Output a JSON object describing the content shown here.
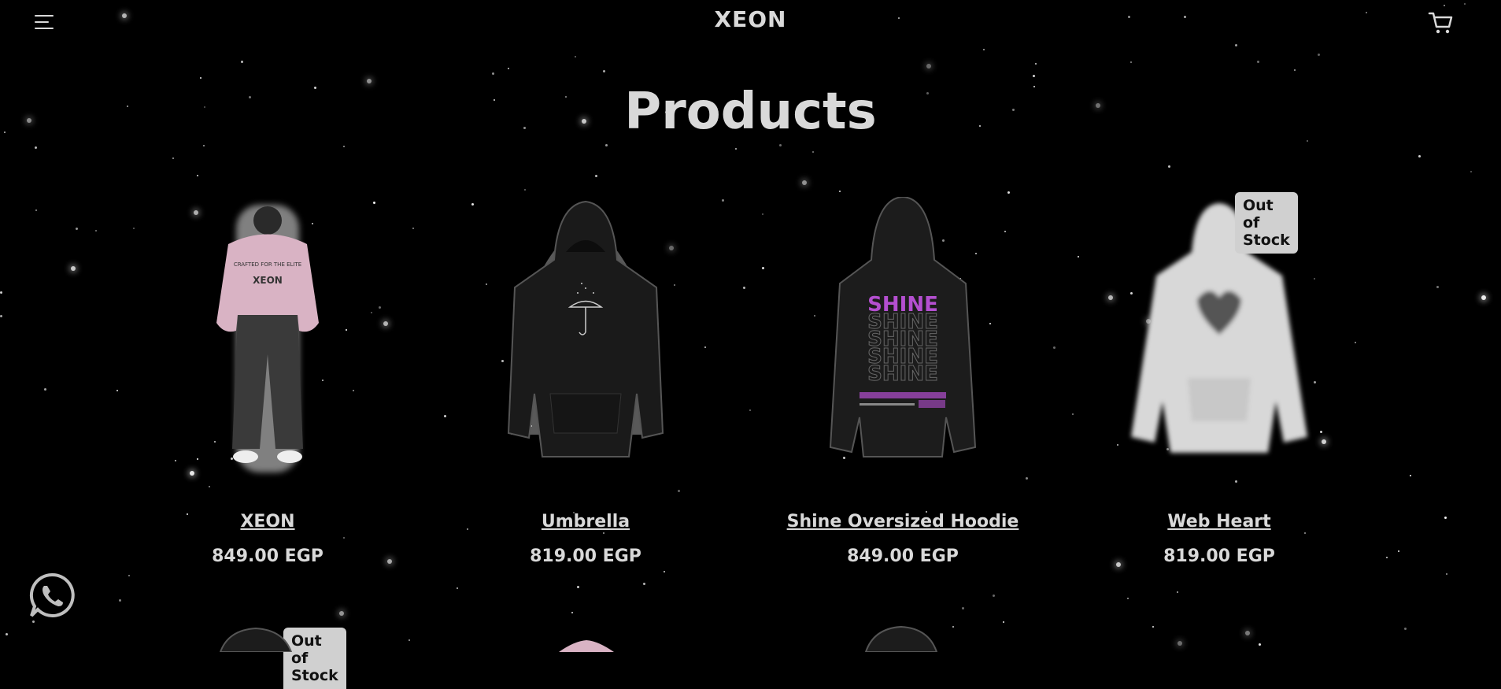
{
  "header": {
    "logo": "XEON",
    "menu_icon": "hamburger-menu-icon",
    "cart_icon": "cart-icon"
  },
  "page": {
    "title": "Products"
  },
  "products": [
    {
      "name": "XEON",
      "price": "849.00 EGP",
      "badge": "",
      "image": "pink-hoodie-model-photo",
      "color": "#d9b3c4"
    },
    {
      "name": "Umbrella",
      "price": "819.00 EGP",
      "badge": "",
      "image": "black-hoodie-umbrella-photo",
      "color": "#1a1a1a"
    },
    {
      "name": "Shine Oversized Hoodie",
      "price": "849.00 EGP",
      "badge": "",
      "image": "black-hoodie-shine-photo",
      "color": "#1a1a1a"
    },
    {
      "name": "Web Heart",
      "price": "819.00 EGP",
      "badge": "Out of Stock",
      "image": "white-hoodie-heart-photo",
      "color": "#d8d8d8"
    }
  ],
  "second_row": [
    {
      "badge": "Out of Stock"
    }
  ],
  "whatsapp": {
    "icon": "whatsapp-icon"
  },
  "colors": {
    "background": "#000000",
    "text": "#d9d9d9",
    "badge_bg": "#d0d0d0",
    "accent_purple": "#b44fd0"
  }
}
